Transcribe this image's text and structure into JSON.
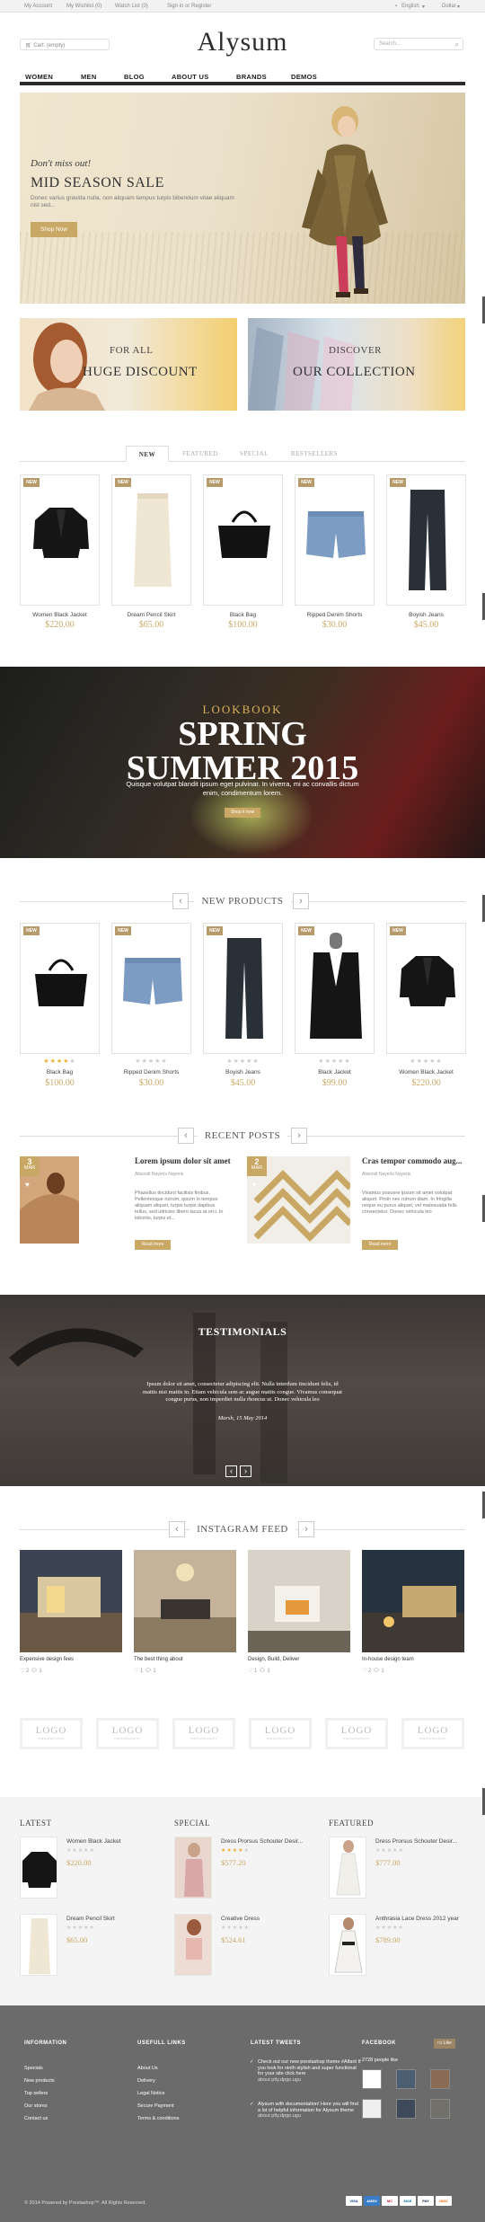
{
  "topbar": {
    "links": [
      "My Account",
      "My Wishlist (0)",
      "Watch List (0)",
      "Sign in or Register"
    ],
    "language": "English",
    "currency": "Dollar"
  },
  "header": {
    "cart": "Cart: (empty)",
    "logo": "Alysum",
    "search_placeholder": "Search..."
  },
  "nav": [
    "WOMEN",
    "MEN",
    "BLOG",
    "ABOUT US",
    "BRANDS",
    "DEMOS"
  ],
  "hero": {
    "kicker": "Don't miss out!",
    "title": "MID SEASON SALE",
    "text": "Donec varius gravida nulla, non aliquam tempus turpis bibendum vitae aliquam nisl sed...",
    "button": "Shop Now"
  },
  "banners": [
    {
      "line1": "FOR ALL",
      "line2": "HUGE DISCOUNT"
    },
    {
      "line1": "DISCOVER",
      "line2": "OUR COLLECTION"
    }
  ],
  "tabs": [
    "NEW",
    "FEATURED",
    "SPECIAL",
    "BESTSELLERS"
  ],
  "featured_products": [
    {
      "badge": "NEW",
      "name": "Women Black Jacket",
      "price": "$220.00"
    },
    {
      "badge": "NEW",
      "name": "Dream Pencil Skirt",
      "price": "$65.00"
    },
    {
      "badge": "NEW",
      "name": "Black Bag",
      "price": "$100.00"
    },
    {
      "badge": "NEW",
      "name": "Ripped Denim Shorts",
      "price": "$30.00"
    },
    {
      "badge": "NEW",
      "name": "Boyish Jeans",
      "price": "$45.00"
    }
  ],
  "lookbook": {
    "kicker": "LOOKBOOK",
    "title1": "SPRING",
    "title2": "SUMMER 2015",
    "text": "Quisque volutpat blandit ipsum eget pulvinar. In viverra, mi ac convallis dictum enim, condimentum lorem.",
    "button": "Shop it now"
  },
  "new_products": {
    "title": "NEW PRODUCTS",
    "items": [
      {
        "badge": "NEW",
        "name": "Black Bag",
        "price": "$100.00",
        "rating": 4
      },
      {
        "badge": "NEW",
        "name": "Ripped Denim Shorts",
        "price": "$30.00",
        "rating": 0
      },
      {
        "badge": "NEW",
        "name": "Boyish Jeans",
        "price": "$45.00",
        "rating": 0
      },
      {
        "badge": "NEW",
        "name": "Black Jacket",
        "price": "$99.00",
        "rating": 0
      },
      {
        "badge": "NEW",
        "name": "Women Black Jacket",
        "price": "$220.00",
        "rating": 0
      }
    ]
  },
  "recent_posts": {
    "title": "RECENT POSTS",
    "posts": [
      {
        "day": "3",
        "month": "MAR",
        "title": "Lorem ipsum dolor sit amet",
        "meta": "Alisondi   Nayeris Nayeris",
        "excerpt": "Phasellus tincidunt facilisis finibus. Pellentesque rutrum, ipsum in tempus aliquam aliquet, turpis turpis dapibus tellus, sed ultricies libero lacus at orci. In lobortis, turpis et...",
        "button": "Read more"
      },
      {
        "day": "2",
        "month": "MAR",
        "title": "Cras tempor commodo aug...",
        "meta": "Alisondi   Nayeris Nayeris",
        "excerpt": "Vivamus posuere ipsum sit amet volutpat aliquet. Proin nec rutrum diam. In fringilla neque eu purus aliquet, vel malesuada felis consectetur. Donec vehicula leo",
        "button": "Read more"
      }
    ]
  },
  "testimonials": {
    "title": "TESTIMONIALS",
    "quote": "Ipsum dolor sit amet, consectetur adipiscing elit. Nulla interdum tincidunt felis, id mattis nisi mattis in. Etiam vehicula sem ac augue mattis congue. Vivamus consequat congue purus, non imperdiet nulla rhoncus ut. Donec vehicula leo",
    "date": "Marsh, 15 May 2014"
  },
  "instagram": {
    "title": "INSTAGRAM FEED",
    "items": [
      {
        "caption": "Expensive design fees",
        "likes": "2",
        "comments": "1"
      },
      {
        "caption": "The best thing about",
        "likes": "1",
        "comments": "1"
      },
      {
        "caption": "Design, Build, Deliver",
        "likes": "1",
        "comments": "1"
      },
      {
        "caption": "In-house design team",
        "likes": "2",
        "comments": "1"
      }
    ]
  },
  "brands": [
    {
      "logo": "LOGO",
      "sub": "manufacturer"
    },
    {
      "logo": "LOGO",
      "sub": "manufacturer"
    },
    {
      "logo": "LOGO",
      "sub": "manufacturer"
    },
    {
      "logo": "LOGO",
      "sub": "manufacturer"
    },
    {
      "logo": "LOGO",
      "sub": "manufacturer"
    },
    {
      "logo": "LOGO",
      "sub": "manufacturer"
    }
  ],
  "product_lists": [
    {
      "title": "LATEST",
      "items": [
        {
          "name": "Women Black Jacket",
          "price": "$220.00",
          "rating": 0
        },
        {
          "name": "Dream Pencil Skirt",
          "price": "$65.00",
          "rating": 0
        }
      ]
    },
    {
      "title": "SPECIAL",
      "items": [
        {
          "name": "Dress Prorsus Schouter Desir...",
          "price": "$577.20",
          "rating": 4
        },
        {
          "name": "Creative Dress",
          "price": "$524.61",
          "rating": 0
        }
      ]
    },
    {
      "title": "FEATURED",
      "items": [
        {
          "name": "Dress Prorsus Schouter Desir...",
          "price": "$777.00",
          "rating": 0
        },
        {
          "name": "Anthrasia Lace Dress 2012 year",
          "price": "$789.00",
          "rating": 0
        }
      ]
    }
  ],
  "footer": {
    "information": {
      "title": "INFORMATION",
      "links": [
        "Specials",
        "New products",
        "Top sellers",
        "Our stores",
        "Contact us"
      ]
    },
    "useful": {
      "title": "USEFULL LINKS",
      "links": [
        "About Us",
        "Delivery",
        "Legal Notice",
        "Secure Payment",
        "Terms & conditions"
      ]
    },
    "tweets": {
      "title": "LATEST TWEETS",
      "items": [
        {
          "text": "Check out our new prestashop theme #Alfarti If you look for ninth stylish and super functional for your site click here",
          "link": "about ptly.dpgo.ugu"
        },
        {
          "text": "Alysum with documentation! Here you will find a lot of helpful information for Alysum theme",
          "link": "about ptly.dpgo.ugu"
        }
      ]
    },
    "facebook": {
      "title": "FACEBOOK",
      "likes": "2728 people like",
      "like_button": "Like"
    },
    "copyright": "© 2014 Powered by Prestashop™. All Rights Reserved.",
    "payments": [
      "VISA",
      "AMEX",
      "MC",
      "MAE",
      "PAY",
      "DISC"
    ]
  },
  "colors": {
    "accent": "#c9a865",
    "footer": "#6b6b6b",
    "nav_rule": "#2a2a2a"
  }
}
